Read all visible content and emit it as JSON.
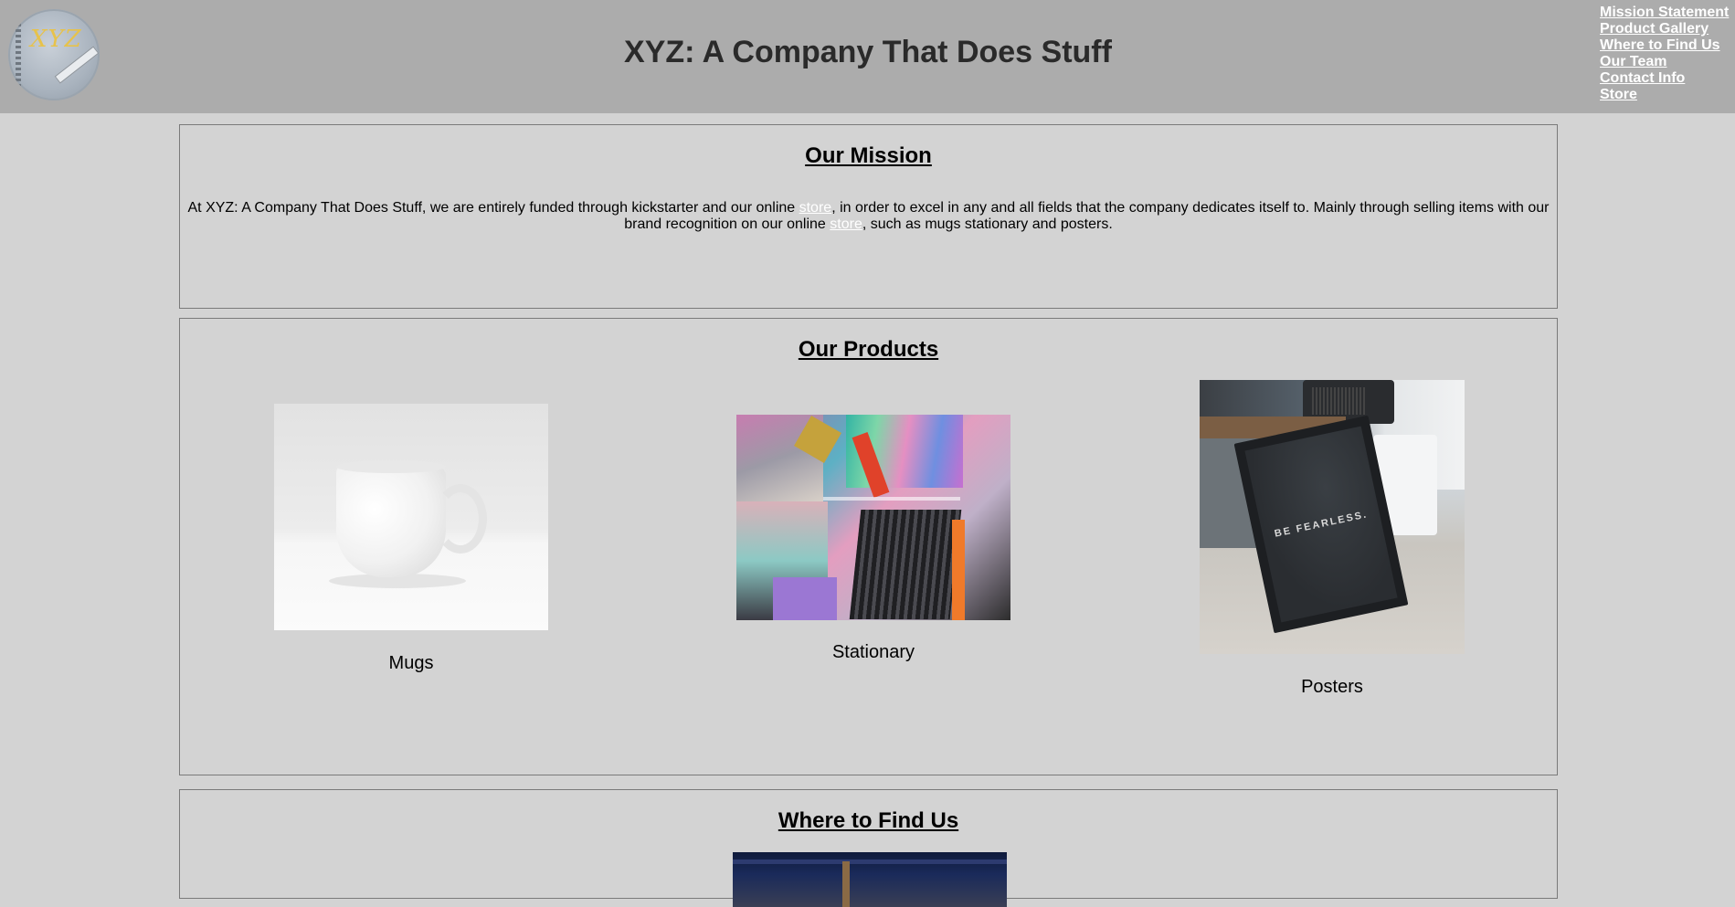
{
  "header": {
    "logo_text": "XYZ",
    "title": "XYZ: A Company That Does Stuff",
    "nav": [
      "Mission Statement",
      "Product Gallery",
      "Where to Find Us",
      "Our Team",
      "Contact Info",
      "Store"
    ]
  },
  "mission": {
    "title": "Our Mission",
    "text_part1": "At XYZ: A Company That Does Stuff, we are entirely funded through kickstarter and our online ",
    "link1": "store",
    "text_part2": ", in order to excel in any and all fields that the company dedicates itself to. Mainly through selling items with our brand recognition on our online ",
    "link2": "store",
    "text_part3": ", such as mugs stationary and posters."
  },
  "products": {
    "title": "Our Products",
    "items": [
      {
        "label": "Mugs",
        "image": "white-mug-photo"
      },
      {
        "label": "Stationary",
        "image": "stationery-supplies-photo"
      },
      {
        "label": "Posters",
        "image": "framed-poster-photo",
        "poster_text": "BE FEARLESS."
      }
    ]
  },
  "find_us": {
    "title": "Where to Find Us",
    "image": "storefront-photo"
  },
  "colors": {
    "page_background": "#d3d3d3",
    "header_background": "#acacac",
    "nav_link": "#ffffff",
    "store_link": "#ffffff"
  }
}
